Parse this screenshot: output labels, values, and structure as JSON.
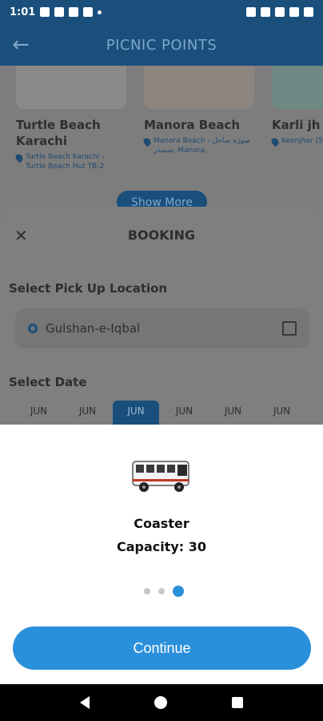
{
  "status_bar": {
    "time": "1:01"
  },
  "app_bar": {
    "title": "PICNIC POINTS",
    "back_icon": "arrow-left-icon"
  },
  "places": [
    {
      "name": "Turtle Beach Karachi",
      "location": "Turtle Beach Karachi - Turtle Beach Hut TB-2"
    },
    {
      "name": "Manora Beach",
      "location": "Manora Beach - منوڑہ ساحل سمندر, Manora,"
    },
    {
      "name": "Karli jh",
      "location": "Keenjhar (STDC),"
    }
  ],
  "show_more_label": "Show More",
  "booking": {
    "title": "BOOKING",
    "pickup_label": "Select Pick Up Location",
    "pickup_value": "Gulshan-e-Iqbal",
    "date_label": "Select Date",
    "dates": [
      "JUN",
      "JUN",
      "JUN",
      "JUN",
      "JUN",
      "JUN"
    ]
  },
  "vehicle": {
    "name": "Coaster",
    "capacity": "Capacity: 30",
    "pager_total": 3,
    "pager_active": 3
  },
  "continue_label": "Continue",
  "colors": {
    "primary": "#1a4f7c",
    "accent": "#2b90dc"
  }
}
